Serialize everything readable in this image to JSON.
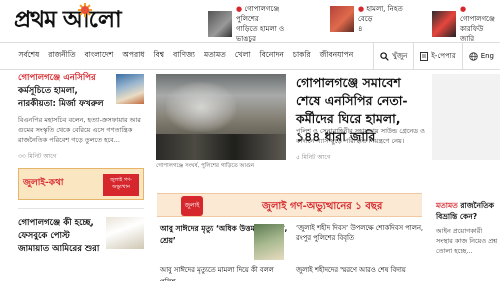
{
  "brand": {
    "logo_text": "প্রথম আলো"
  },
  "teasers": [
    {
      "lines": [
        "গোপালগঞ্জে পুলিশের",
        "গাড়িতে হামলা ও ভাঙচুর"
      ]
    },
    {
      "lines": [
        "হামলা, নিহত বেড়ে",
        "৪"
      ]
    },
    {
      "lines": [
        "গোপালগঞ্জে কারফিউ",
        "জারি"
      ]
    }
  ],
  "nav": {
    "items": [
      "সর্বশেষ",
      "রাজনীতি",
      "বাংলাদেশ",
      "অপরাধ",
      "বিশ্ব",
      "বাণিজ্য",
      "মতামত",
      "খেলা",
      "বিনোদন",
      "চাকরি",
      "জীবনযাপন"
    ],
    "search_label": "খুঁজুন",
    "epaper_label": "ই-পেপার",
    "lang_label": "Eng"
  },
  "left": {
    "story1": {
      "headline_lead": "গোপালগঞ্জে এনসিপির",
      "headline_rest": "কর্মসূচিতে হামলা, নারকীয়তা: মির্জা ফখরুল",
      "lede": "বিএনপির মহাসচিব বলেন, হত্যা-ক্রসফায়ার আর গুমের সংস্কৃতি থেকে বেরিয়ে এসে গণতান্ত্রিক রাজনৈতিক পরিবেশ গড়ে তুলতে হবে...",
      "time": "৩৩ মিনিট আগে"
    },
    "banner": {
      "title": "জুলাই-কথা",
      "right_text": "জুলাই গণ-অভ্যুত্থান"
    },
    "story2": {
      "headline": "গোপালগঞ্জে কী হচ্ছে, ফেসবুকে পোস্ট জামায়াত আমিরের শুরা"
    }
  },
  "center": {
    "hero_caption": "গোপালগঞ্জে সংঘর্ষ, পুলিশের গাড়িতে আগুন",
    "main_headline": "গোপালগঞ্জে সমাবেশ শেষে এনসিপির নেতা-কর্মীদের ঘিরে হামলা, ১৪৪ ধারা জারি",
    "main_lede": "পুলিশ ও সেনাবাহিনীর সহায়তায় সাউন্ড গ্রেনেড ও কাঁদানে গ্যাস ছুড়ে পরিস্থিতি নিয়ন্ত্রণে নেয়।",
    "main_time": "৫ মিনিট আগে",
    "strip_text": "জুলাই গণ-অভ্যুত্থানের ১ বছর",
    "strip_badge": "জুলাই",
    "sub1": "আবু সাঈদের মৃত্যু ‘অধিক উত্তম, সম্মানের, শ্রেয়’",
    "sub2": "‘জুলাই শহীদ দিবস’ উপলক্ষে শোকদিবস পালন, রংপুর পুলিশের বিবৃতি",
    "sub3": "আবু সাঈদের মৃত্যুতে মামলা দিয়ে কী বলল পুলিশ",
    "sub4": "জুলাই শহীদদের স্মরণে আরও শেষ বিদায়"
  },
  "right": {
    "headline_lead": "মতামত",
    "headline_rest": "রাজনৈতিক বিভ্রান্তি কেন?",
    "lede": "আইন প্রয়োগকারী সংস্থার কাজ নিয়েও প্রশ্ন তোলা হচ্ছে..."
  }
}
